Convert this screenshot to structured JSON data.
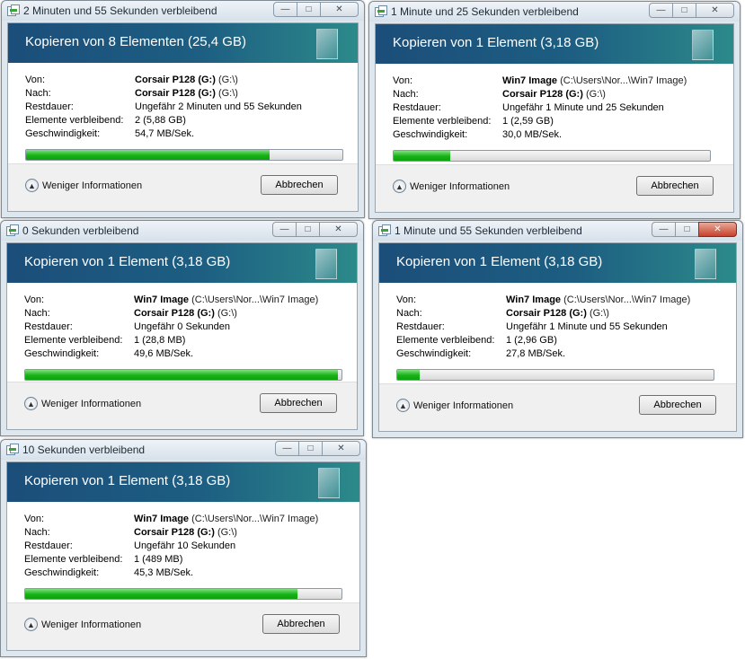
{
  "labels": {
    "from": "Von:",
    "to": "Nach:",
    "remaining_time": "Restdauer:",
    "items_remaining": "Elemente verbleibend:",
    "speed": "Geschwindigkeit:",
    "less_info": "Weniger Informationen",
    "cancel": "Abbrechen"
  },
  "window_buttons": {
    "minimize": "—",
    "maximize": "□",
    "close": "✕"
  },
  "dialogs": [
    {
      "title": "2 Minuten und 55 Sekunden verbleibend",
      "heading": "Kopieren von 8 Elementen (25,4 GB)",
      "from_name": "Corsair P128 (G:)",
      "from_path": "(G:\\)",
      "to_name": "Corsair P128 (G:)",
      "to_path": "(G:\\)",
      "remaining": "Ungefähr 2 Minuten und 55 Sekunden",
      "items": "2 (5,88 GB)",
      "speed": "54,7 MB/Sek.",
      "progress": 0.77
    },
    {
      "title": "1 Minute und 25 Sekunden verbleibend",
      "heading": "Kopieren von 1 Element (3,18 GB)",
      "from_name": "Win7 Image",
      "from_path": "(C:\\Users\\Nor...\\Win7 Image)",
      "to_name": "Corsair P128 (G:)",
      "to_path": "(G:\\)",
      "remaining": "Ungefähr 1 Minute und 25 Sekunden",
      "items": "1 (2,59 GB)",
      "speed": "30,0 MB/Sek.",
      "progress": 0.18
    },
    {
      "title": "0 Sekunden verbleibend",
      "heading": "Kopieren von 1 Element (3,18 GB)",
      "from_name": "Win7 Image",
      "from_path": "(C:\\Users\\Nor...\\Win7 Image)",
      "to_name": "Corsair P128 (G:)",
      "to_path": "(G:\\)",
      "remaining": "Ungefähr 0 Sekunden",
      "items": "1 (28,8 MB)",
      "speed": "49,6 MB/Sek.",
      "progress": 0.99
    },
    {
      "title": "1 Minute und 55 Sekunden verbleibend",
      "heading": "Kopieren von 1 Element (3,18 GB)",
      "from_name": "Win7 Image",
      "from_path": "(C:\\Users\\Nor...\\Win7 Image)",
      "to_name": "Corsair P128 (G:)",
      "to_path": "(G:\\)",
      "remaining": "Ungefähr 1 Minute und 55 Sekunden",
      "items": "1 (2,96 GB)",
      "speed": "27,8 MB/Sek.",
      "progress": 0.07
    },
    {
      "title": "10 Sekunden verbleibend",
      "heading": "Kopieren von 1 Element (3,18 GB)",
      "from_name": "Win7 Image",
      "from_path": "(C:\\Users\\Nor...\\Win7 Image)",
      "to_name": "Corsair P128 (G:)",
      "to_path": "(G:\\)",
      "remaining": "Ungefähr 10 Sekunden",
      "items": "1 (489 MB)",
      "speed": "45,3 MB/Sek.",
      "progress": 0.86
    }
  ]
}
